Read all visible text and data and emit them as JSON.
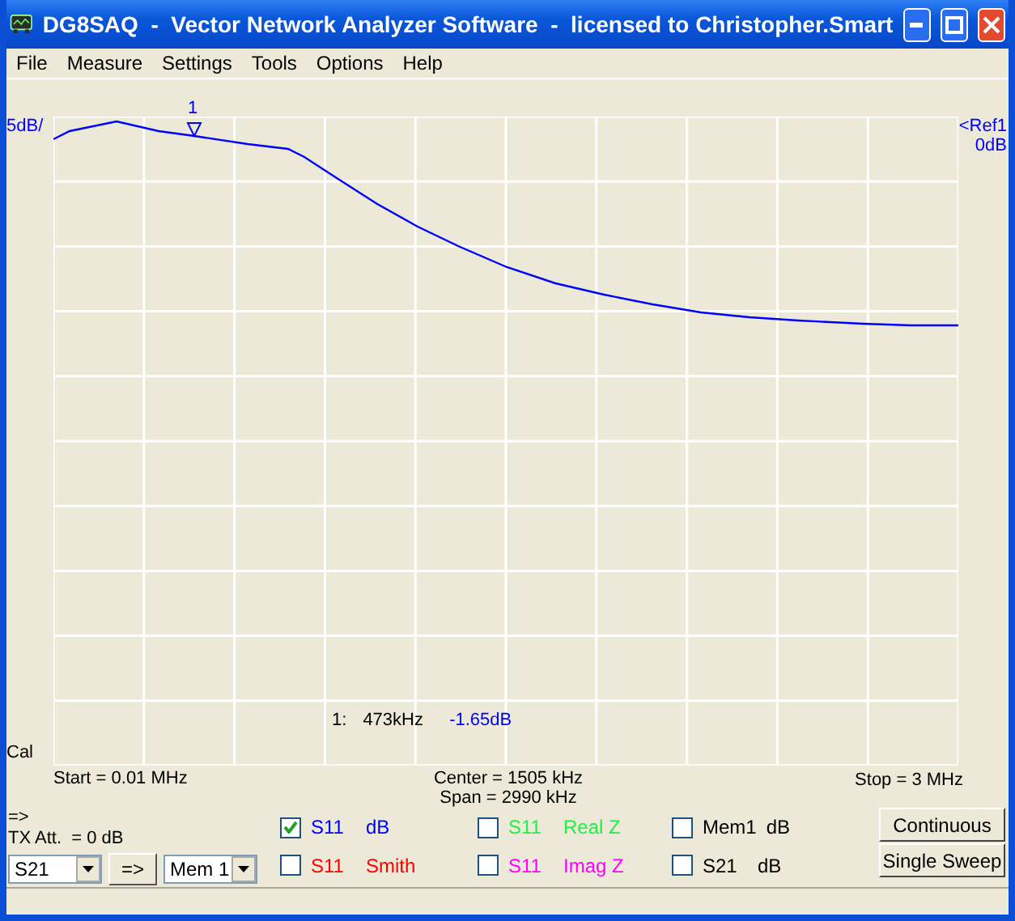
{
  "window": {
    "title": "DG8SAQ  -  Vector Network Analyzer Software  -  licensed to Christopher.Smart"
  },
  "menu": [
    "File",
    "Measure",
    "Settings",
    "Tools",
    "Options",
    "Help"
  ],
  "chart": {
    "scale": "5dB/",
    "ref_label": "<Ref1",
    "ref_value": "0dB",
    "cal": "Cal",
    "readout": {
      "index": "1:",
      "freq": "473kHz",
      "value": "-1.65dB"
    },
    "start": "Start = 0.01 MHz",
    "center": "Center = 1505 kHz",
    "span": "Span = 2990 kHz",
    "stop": "Stop = 3 MHz",
    "marker_label": "1"
  },
  "controls": {
    "arrow": "=>",
    "tx_att": "TX Att.  = 0 dB",
    "source": "S21",
    "copy_button": "=>",
    "target": "Mem 1"
  },
  "traces": [
    {
      "param": "S11",
      "format": "dB",
      "checked": true,
      "color": "#0000ff"
    },
    {
      "param": "S11",
      "format": "Real Z",
      "checked": false,
      "color": "#22ee44"
    },
    {
      "param": "Mem1",
      "format": "dB",
      "checked": false,
      "color": "#000000"
    },
    {
      "param": "S11",
      "format": "Smith",
      "checked": false,
      "color": "#ff0000"
    },
    {
      "param": "S11",
      "format": "Imag Z",
      "checked": false,
      "color": "#ff00ff"
    },
    {
      "param": "S21",
      "format": "dB",
      "checked": false,
      "color": "#000000"
    }
  ],
  "buttons": [
    "Continuous",
    "Single Sweep"
  ]
}
